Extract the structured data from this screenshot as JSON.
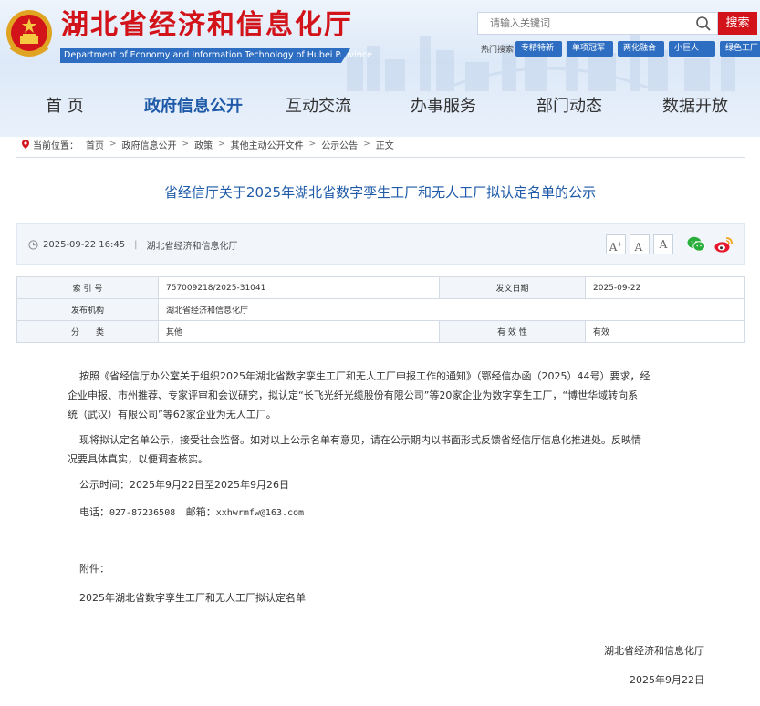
{
  "header": {
    "title": "湖北省经济和信息化厅",
    "subtitle": "Department of Economy and Information Technology of Hubei Province",
    "search": {
      "placeholder": "请输入关键词",
      "button": "搜索"
    },
    "hot_label": "热门搜索：",
    "hot_tags": [
      "专精特新",
      "单项冠军",
      "两化融合",
      "小巨人",
      "绿色工厂"
    ]
  },
  "nav": [
    "首 页",
    "政府信息公开",
    "互动交流",
    "办事服务",
    "部门动态",
    "数据开放"
  ],
  "nav_active": 1,
  "breadcrumb": {
    "label": "当前位置：",
    "items": [
      "首页",
      "政府信息公开",
      "政策",
      "其他主动公开文件",
      "公示公告",
      "正文"
    ]
  },
  "article": {
    "title": "省经信厅关于2025年湖北省数字孪生工厂和无人工厂拟认定名单的公示",
    "date": "2025-09-22 16:45",
    "source": "湖北省经济和信息化厅",
    "font_sizes": [
      "A",
      "A",
      "A"
    ]
  },
  "info": {
    "index_label": "索 引 号",
    "index_value": "757009218/2025-31041",
    "date_label": "发文日期",
    "date_value": "2025-09-22",
    "publisher_label": "发布机构",
    "publisher_value": "湖北省经济和信息化厅",
    "category_label": "分　　类",
    "category_value": "其他",
    "validity_label": "有 效 性",
    "validity_value": "有效"
  },
  "content": {
    "p1_line1": "按照《省经信厅办公室关于组织2025年湖北省数字孪生工厂和无人工厂申报工作的通知》（鄂经信办函（2025）44号）要求，经",
    "p1_line2": "企业申报、市州推荐、专家评审和会议研究，拟认定“长飞光纤光缆股份有限公司”等20家企业为数字孪生工厂，“博世华域转向系",
    "p1_line3": "统（武汉）有限公司”等62家企业为无人工厂。",
    "p2_line1": "现将拟认定名单公示，接受社会监督。如对以上公示名单有意见，请在公示期内以书面形式反馈省经信厅信息化推进处。反映情",
    "p2_line2": "况要具体真实，以便调查核实。",
    "period": "公示时间：2025年9月22日至2025年9月26日",
    "phone_label": "电话：",
    "phone": "027-87236508",
    "email_label": "邮箱：",
    "email": "xxhwrmfw@163.com",
    "attachment_label": "附件：",
    "attachment": "2025年湖北省数字孪生工厂和无人工厂拟认定名单",
    "signature": "湖北省经济和信息化厅",
    "sign_date": "2025年9月22日"
  },
  "colors": {
    "brand_red": "#d2131a",
    "brand_blue": "#1e5aa8",
    "tag_blue": "#2e6ec2"
  }
}
